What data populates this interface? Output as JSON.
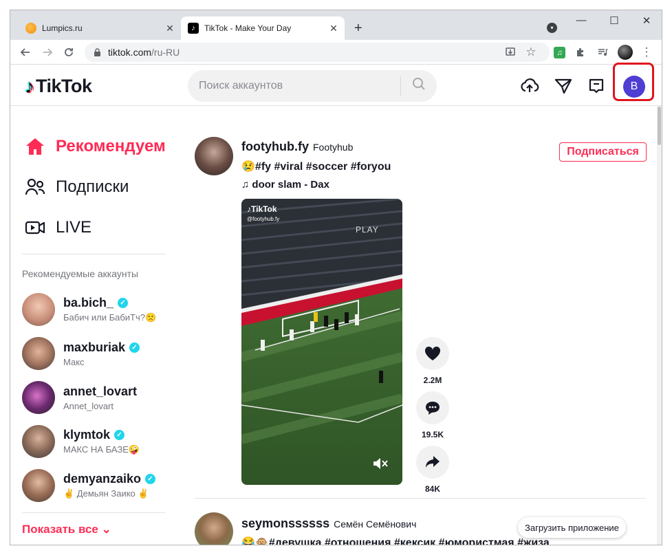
{
  "browser": {
    "tabs": [
      {
        "title": "Lumpics.ru",
        "active": false
      },
      {
        "title": "TikTok - Make Your Day",
        "active": true
      }
    ],
    "new_tab": "+",
    "close": "✕",
    "minimize": "—",
    "maximize": "☐",
    "window_close": "✕",
    "url_host": "tiktok.com",
    "url_path": "/ru-RU",
    "extension_icon": "♫"
  },
  "header": {
    "logo": "TikTok",
    "search_placeholder": "Поиск аккаунтов",
    "avatar_letter": "B",
    "icons": [
      "upload-icon",
      "send-icon",
      "inbox-icon"
    ]
  },
  "sidebar": {
    "nav": [
      {
        "label": "Рекомендуем",
        "icon": "home-icon",
        "active": true
      },
      {
        "label": "Подписки",
        "icon": "following-icon",
        "active": false
      },
      {
        "label": "LIVE",
        "icon": "live-icon",
        "active": false
      }
    ],
    "section_title": "Рекомендуемые аккаунты",
    "accounts": [
      {
        "username": "ba.bich_",
        "display": "Бабич или БабиТч?🙁",
        "verified": true
      },
      {
        "username": "maxburiak",
        "display": "Макс",
        "verified": true
      },
      {
        "username": "annet_lovart",
        "display": "Annet_lovart",
        "verified": false
      },
      {
        "username": "klymtok",
        "display": "МАКС НА БАЗЕ🤪",
        "verified": true
      },
      {
        "username": "demyanzaiko",
        "display": "✌️ Демьян Заико ✌️",
        "verified": true
      }
    ],
    "show_all": "Показать все ⌄"
  },
  "feed": {
    "posts": [
      {
        "username": "footyhub.fy",
        "display_name": "Footyhub",
        "caption": "😢#fy #viral #soccer #foryou",
        "music": "♫  door slam - Dax",
        "follow": "Подписаться",
        "video_watermark": "TikTok",
        "video_handle": "@footyhub.fy",
        "video_tag": "PLAY",
        "likes": "2.2M",
        "comments": "19.5K",
        "shares": "84K"
      },
      {
        "username": "seymonssssss",
        "display_name": "Семён Семёнович",
        "caption": "😂🙊#девушка #отношения #кексик #юмористмая #жиза"
      }
    ],
    "get_app": "Загрузить приложение"
  },
  "colors": {
    "accent": "#fe2c55",
    "avatar": "#4f3ed3",
    "highlight": "#e0141e"
  }
}
